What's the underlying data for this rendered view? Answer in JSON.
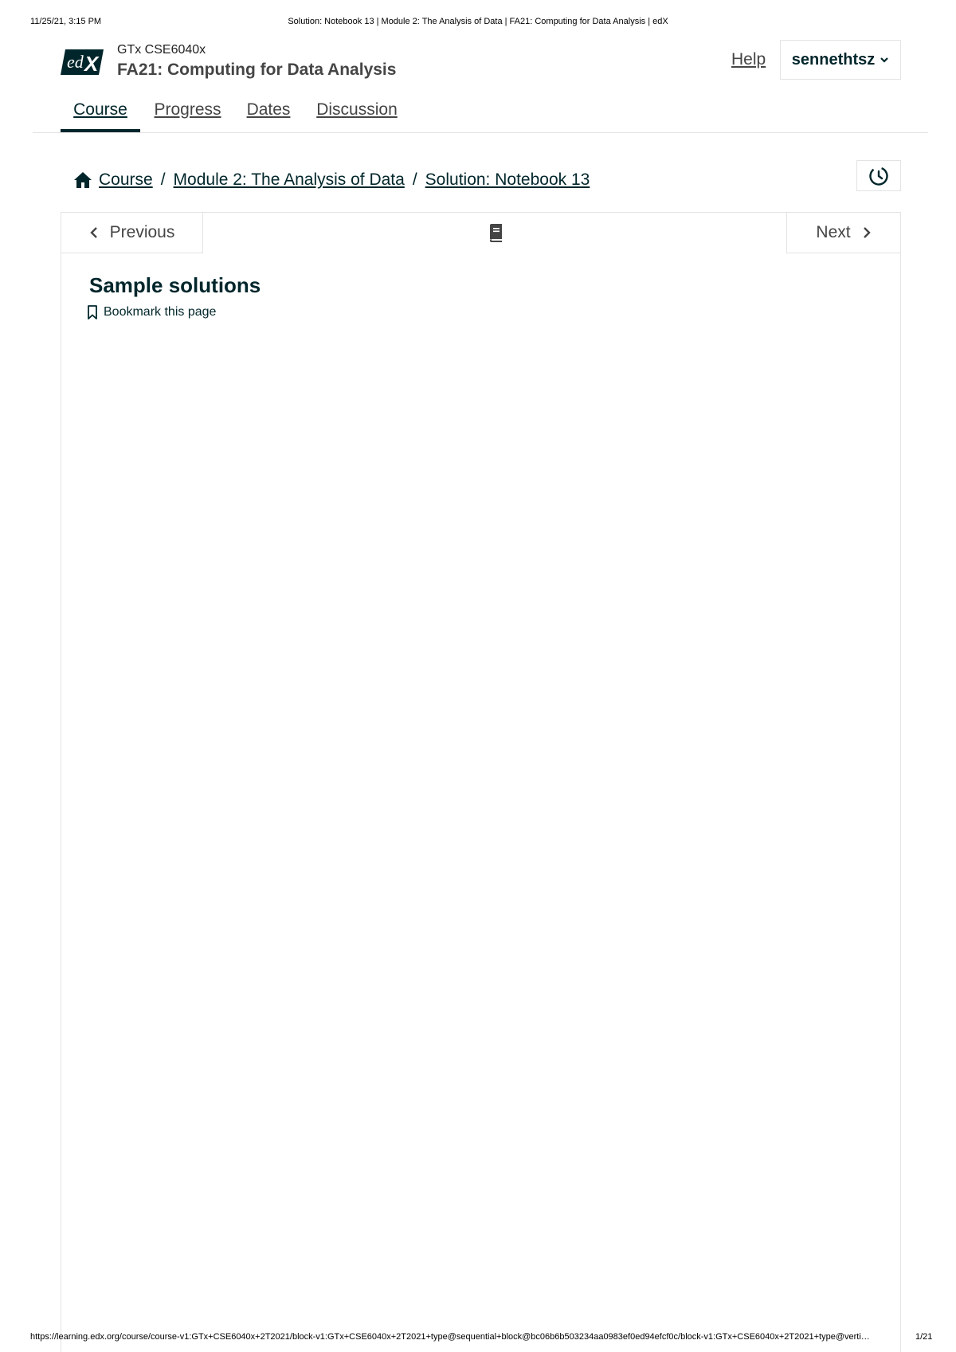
{
  "print_header": {
    "datetime": "11/25/21, 3:15 PM",
    "page_title": "Solution: Notebook 13 | Module 2: The Analysis of Data | FA21: Computing for Data Analysis | edX"
  },
  "header": {
    "logo_text": "edX",
    "course_org": "GTx CSE6040x",
    "course_title": "FA21: Computing for Data Analysis",
    "help_label": "Help",
    "username": "sennethtsz"
  },
  "nav_tabs": [
    {
      "label": "Course",
      "active": true
    },
    {
      "label": "Progress",
      "active": false
    },
    {
      "label": "Dates",
      "active": false
    },
    {
      "label": "Discussion",
      "active": false
    }
  ],
  "breadcrumb": {
    "items": [
      "Course",
      "Module 2: The Analysis of Data",
      "Solution: Notebook 13"
    ],
    "separator": "/"
  },
  "sequence_nav": {
    "previous_label": "Previous",
    "next_label": "Next"
  },
  "unit": {
    "title": "Sample solutions",
    "bookmark_label": "Bookmark this page"
  },
  "print_footer": {
    "url": "https://learning.edx.org/course/course-v1:GTx+CSE6040x+2T2021/block-v1:GTx+CSE6040x+2T2021+type@sequential+block@bc06b6b503234aa0983ef0ed94efcf0c/block-v1:GTx+CSE6040x+2T2021+type@verti…",
    "page_number": "1/21"
  },
  "colors": {
    "brand_dark": "#00262b",
    "text_gray": "#454545",
    "border": "#e3e3e3"
  },
  "icons": [
    "edx-logo",
    "chevron-down-icon",
    "home-icon",
    "history-icon",
    "chevron-left-icon",
    "book-icon",
    "chevron-right-icon",
    "bookmark-icon"
  ]
}
